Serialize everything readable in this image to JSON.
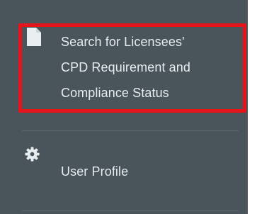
{
  "sidebar": {
    "items": [
      {
        "label_lines": [
          "Search for Licensees'",
          "CPD Requirement and",
          "Compliance Status"
        ],
        "icon": "file-icon",
        "highlighted": true
      },
      {
        "label": "User Profile",
        "icon": "gear-icon"
      }
    ]
  },
  "colors": {
    "sidebar_bg": "#49555b",
    "text": "#e7ecef",
    "divider": "#5c686d",
    "highlight_border": "#e8141c"
  }
}
